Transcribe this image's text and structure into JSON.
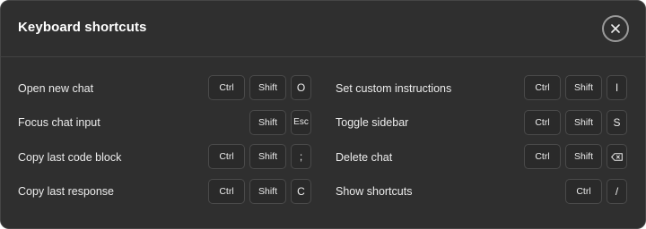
{
  "title": "Keyboard shortcuts",
  "left": [
    {
      "label": "Open new chat",
      "keys": [
        "Ctrl",
        "Shift",
        "O"
      ]
    },
    {
      "label": "Focus chat input",
      "keys": [
        "Shift",
        "Esc"
      ]
    },
    {
      "label": "Copy last code block",
      "keys": [
        "Ctrl",
        "Shift",
        ";"
      ]
    },
    {
      "label": "Copy last response",
      "keys": [
        "Ctrl",
        "Shift",
        "C"
      ]
    }
  ],
  "right": [
    {
      "label": "Set custom instructions",
      "keys": [
        "Ctrl",
        "Shift",
        "I"
      ]
    },
    {
      "label": "Toggle sidebar",
      "keys": [
        "Ctrl",
        "Shift",
        "S"
      ]
    },
    {
      "label": "Delete chat",
      "keys": [
        "Ctrl",
        "Shift",
        "backspace-icon"
      ]
    },
    {
      "label": "Show shortcuts",
      "keys": [
        "Ctrl",
        "/"
      ]
    }
  ]
}
